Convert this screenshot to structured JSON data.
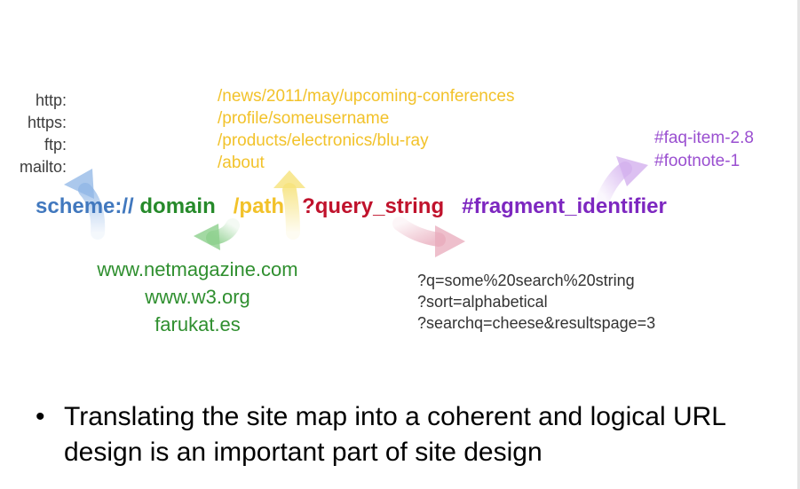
{
  "schemes": [
    "http:",
    "https:",
    "ftp:",
    "mailto:"
  ],
  "paths": [
    "/news/2011/may/upcoming-conferences",
    "/profile/someusername",
    "/products/electronics/blu-ray",
    "/about"
  ],
  "fragments": [
    "#faq-item-2.8",
    "#footnote-1"
  ],
  "url_parts": {
    "scheme": "scheme://",
    "domain": "domain",
    "path": "/path",
    "query": "?query_string",
    "fragment": "#fragment_identifier"
  },
  "domains": [
    "www.netmagazine.com",
    "www.w3.org",
    "farukat.es"
  ],
  "queries": [
    "?q=some%20search%20string",
    "?sort=alphabetical",
    "?searchq=cheese&resultspage=3"
  ],
  "bullet": {
    "marker": "•",
    "text": "Translating the site map into a coherent and logical URL design is an important part of site design"
  },
  "colors": {
    "scheme": "#4178be",
    "domain": "#268a2a",
    "path": "#f2c22a",
    "query": "#c0122c",
    "fragment": "#7d27c0"
  }
}
